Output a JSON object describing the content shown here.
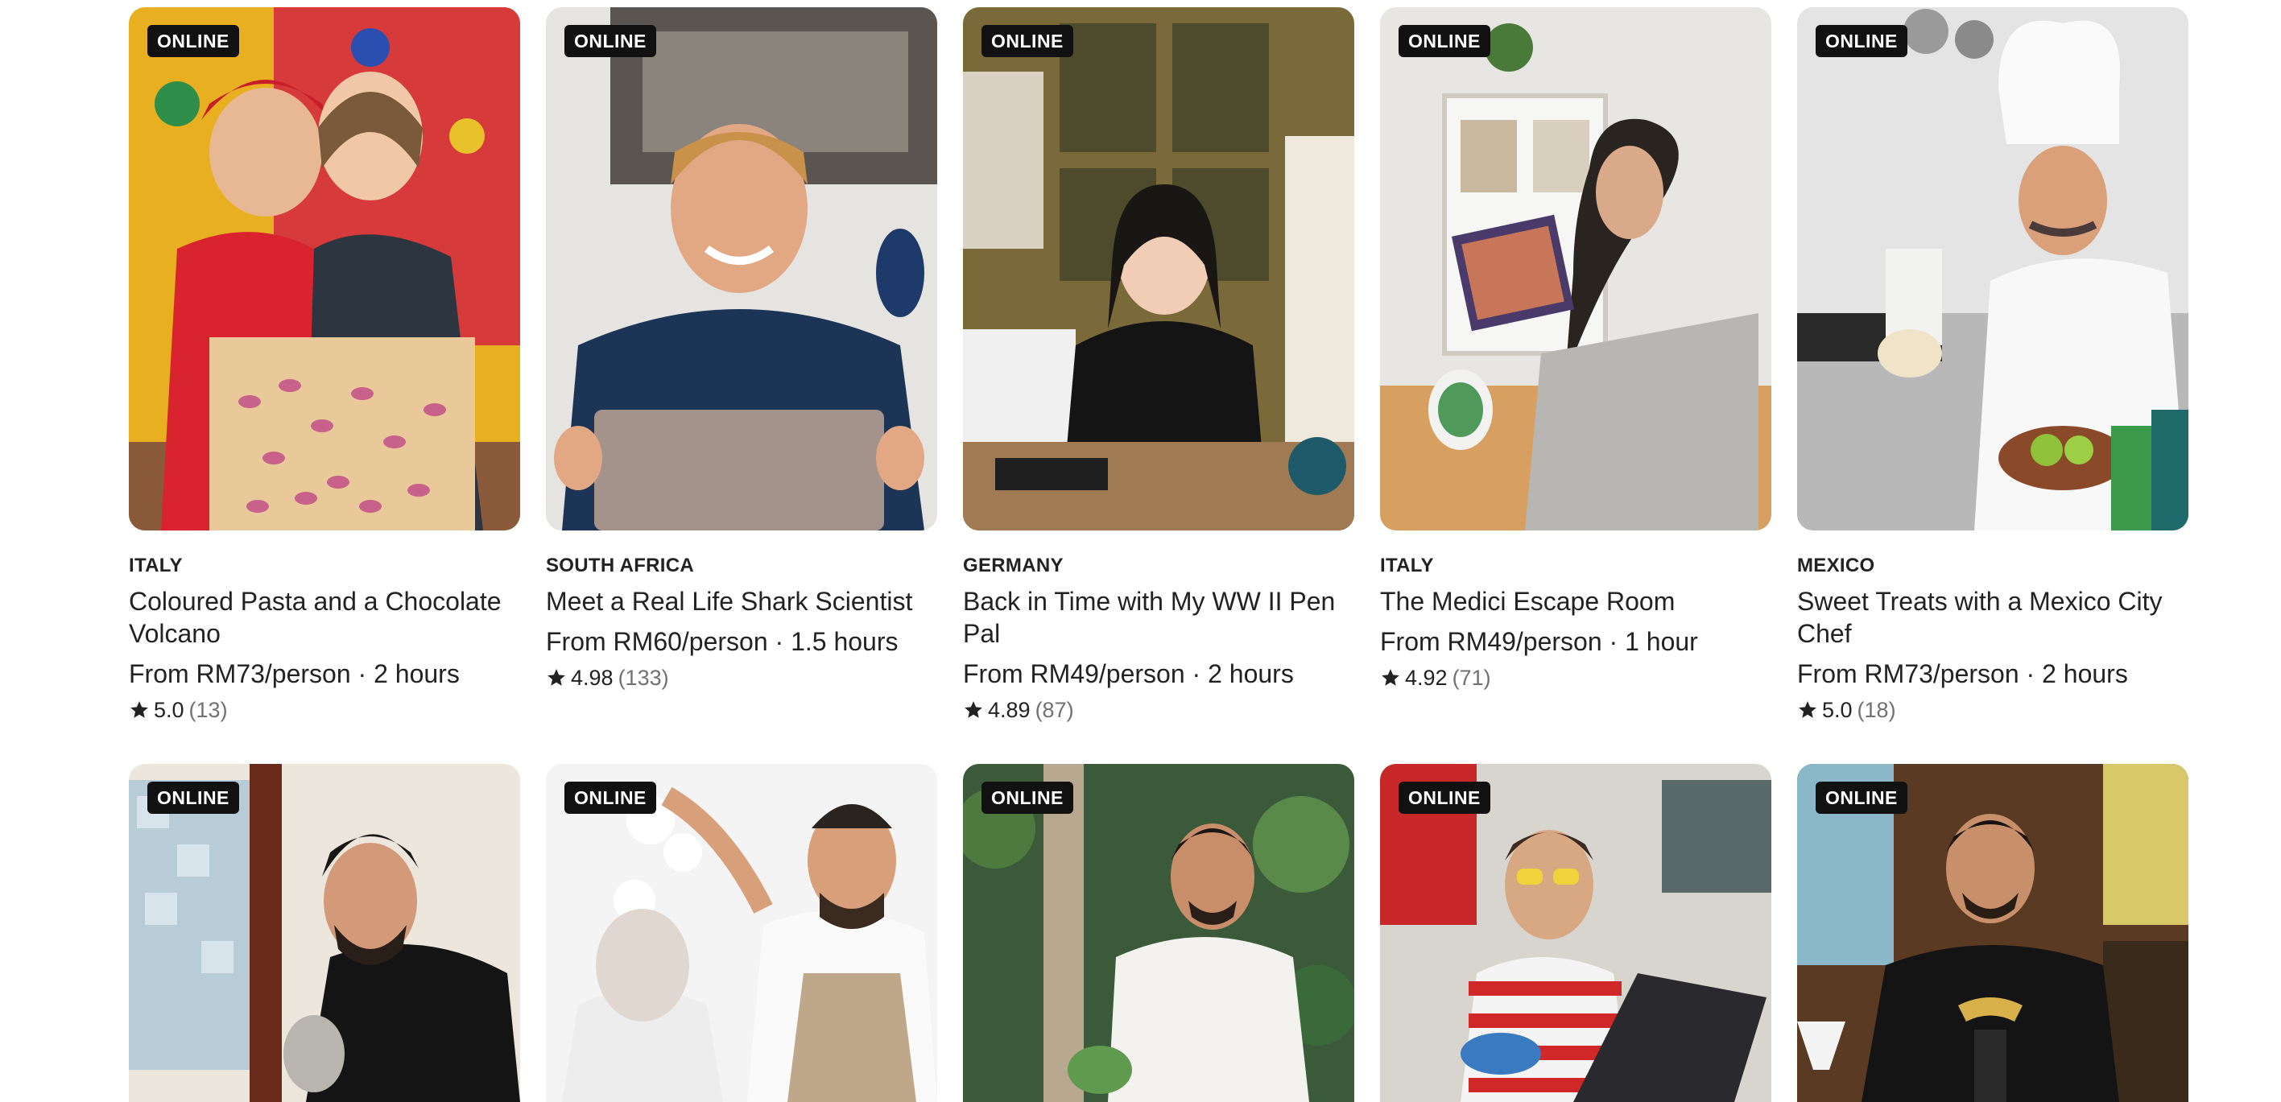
{
  "badge_label": "ONLINE",
  "experiences": [
    {
      "country": "ITALY",
      "title": "Coloured Pasta and a Chocolate Volcano",
      "price": "From RM73/person · 2 hours",
      "score": "5.0",
      "reviews": "(13)",
      "scene": "pasta-chefs"
    },
    {
      "country": "SOUTH AFRICA",
      "title": "Meet a Real Life Shark Scientist",
      "price": "From RM60/person · 1.5 hours",
      "score": "4.98",
      "reviews": "(133)",
      "scene": "man-with-laptop"
    },
    {
      "country": "GERMANY",
      "title": "Back in Time with My WW II Pen Pal",
      "price": "From RM49/person · 2 hours",
      "score": "4.89",
      "reviews": "(87)",
      "scene": "woman-in-kitchen"
    },
    {
      "country": "ITALY",
      "title": "The Medici Escape Room",
      "price": "From RM49/person · 1 hour",
      "score": "4.92",
      "reviews": "(71)",
      "scene": "woman-with-painting"
    },
    {
      "country": "MEXICO",
      "title": "Sweet Treats with a Mexico City Chef",
      "price": "From RM73/person · 2 hours",
      "score": "5.0",
      "reviews": "(18)",
      "scene": "chef-cooking"
    }
  ],
  "more_experiences": [
    {
      "scene": "man-pouring-coffee"
    },
    {
      "scene": "bakers-with-flour"
    },
    {
      "scene": "man-in-garden"
    },
    {
      "scene": "man-with-laptop-glasses"
    },
    {
      "scene": "barista-pour-over"
    }
  ],
  "colors": {
    "badge_bg": "#111111",
    "badge_text": "#ffffff",
    "text": "#222222",
    "muted": "#717171"
  },
  "icons": {
    "rating": "star-icon"
  }
}
